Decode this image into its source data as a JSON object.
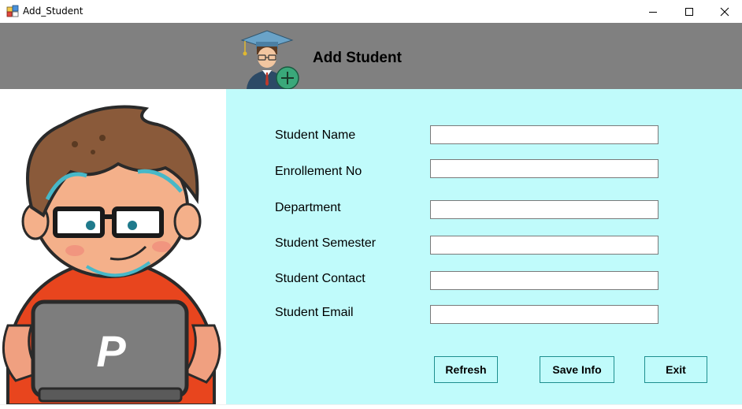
{
  "window": {
    "title": "Add_Student",
    "icon": "winforms-app-icon",
    "controls": [
      "minimize-icon",
      "maximize-icon",
      "close-icon"
    ]
  },
  "header": {
    "title": "Add Student",
    "logo": "graduate-add-icon",
    "background": "#808080"
  },
  "illustration": {
    "name": "student-with-laptop-illustration",
    "laptop_letter": "P"
  },
  "form": {
    "background": "#c0fbfb",
    "fields": [
      {
        "label": "Student Name",
        "value": ""
      },
      {
        "label": "Enrollement No",
        "value": ""
      },
      {
        "label": "Department",
        "value": ""
      },
      {
        "label": "Student Semester",
        "value": ""
      },
      {
        "label": "Student Contact",
        "value": ""
      },
      {
        "label": "Student Email",
        "value": ""
      }
    ],
    "buttons": {
      "refresh": "Refresh",
      "save": "Save Info",
      "exit": "Exit"
    }
  }
}
